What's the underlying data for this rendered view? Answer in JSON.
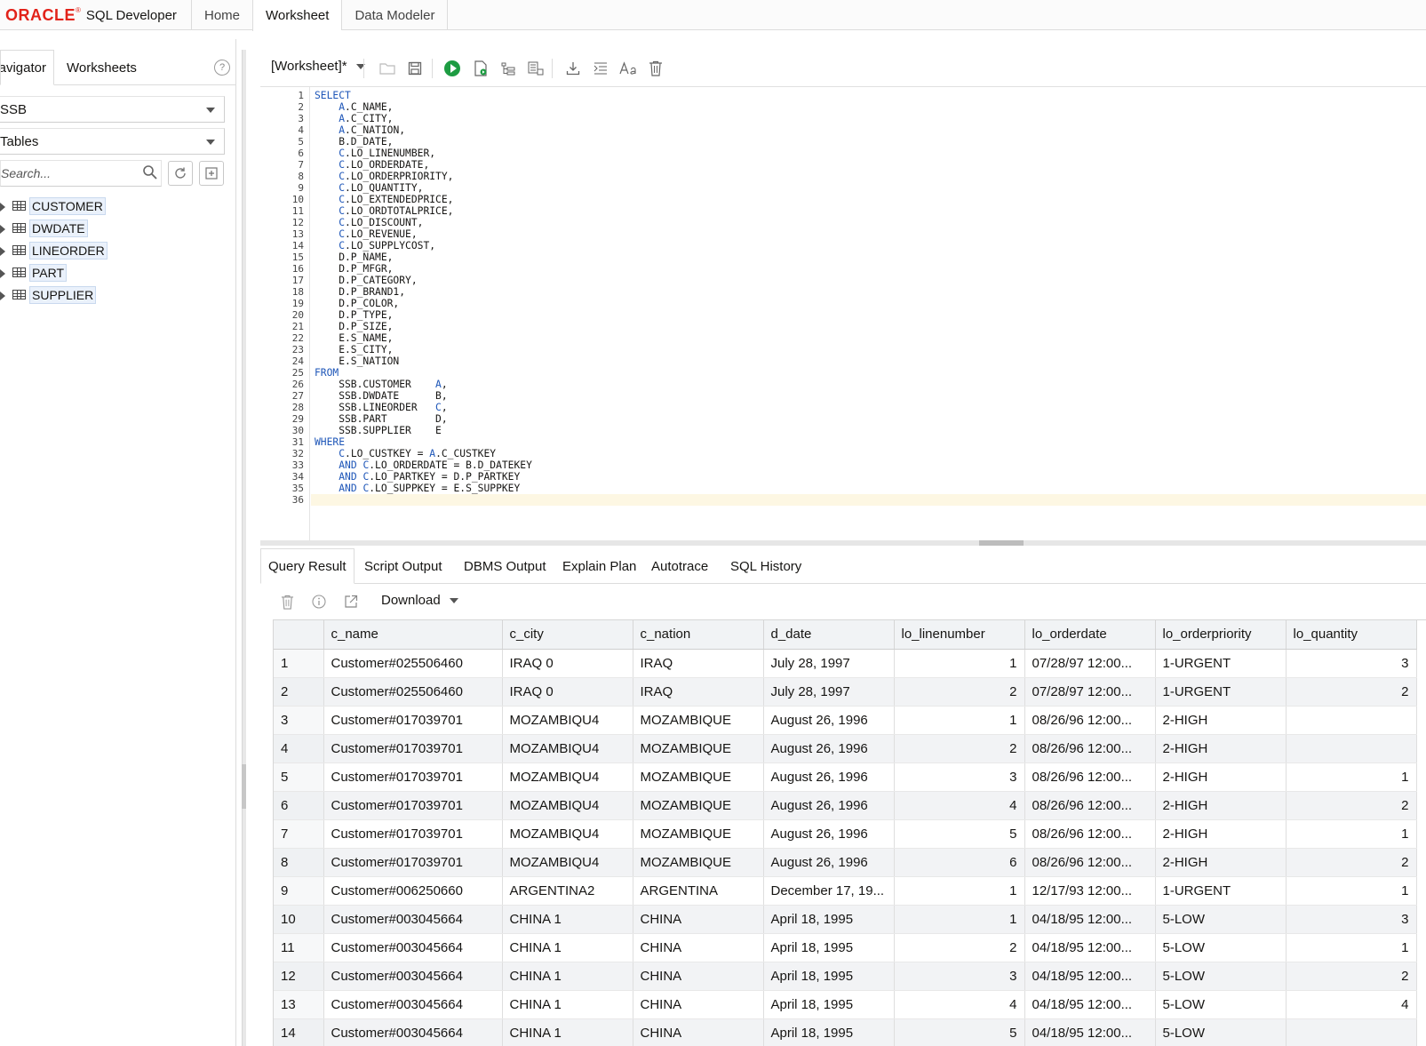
{
  "app": {
    "brand_oracle": "ORACLE",
    "brand_reg": "®",
    "brand_product": "SQL Developer",
    "tabs": [
      "Home",
      "Worksheet",
      "Data Modeler"
    ],
    "accent": "#e2231a"
  },
  "left": {
    "tab_navigator": "avigator",
    "tab_worksheets": "Worksheets",
    "help": "?",
    "schema": "SSB",
    "object_type": "Tables",
    "search_placeholder": "Search...",
    "tables": [
      "CUSTOMER",
      "DWDATE",
      "LINEORDER",
      "PART",
      "SUPPLIER"
    ]
  },
  "worksheet": {
    "title": "[Worksheet]*"
  },
  "editor": {
    "lines": [
      [
        [
          "kw",
          "SELECT"
        ]
      ],
      [
        [
          "",
          "    "
        ],
        [
          "kw",
          "A"
        ],
        [
          "",
          ".C_NAME,"
        ]
      ],
      [
        [
          "",
          "    "
        ],
        [
          "kw",
          "A"
        ],
        [
          "",
          ".C_CITY,"
        ]
      ],
      [
        [
          "",
          "    "
        ],
        [
          "kw",
          "A"
        ],
        [
          "",
          ".C_NATION,"
        ]
      ],
      [
        [
          "",
          "    B.D_DATE,"
        ]
      ],
      [
        [
          "",
          "    "
        ],
        [
          "kw",
          "C"
        ],
        [
          "",
          ".LO_LINENUMBER,"
        ]
      ],
      [
        [
          "",
          "    "
        ],
        [
          "kw",
          "C"
        ],
        [
          "",
          ".LO_ORDERDATE,"
        ]
      ],
      [
        [
          "",
          "    "
        ],
        [
          "kw",
          "C"
        ],
        [
          "",
          ".LO_ORDERPRIORITY,"
        ]
      ],
      [
        [
          "",
          "    "
        ],
        [
          "kw",
          "C"
        ],
        [
          "",
          ".LO_QUANTITY,"
        ]
      ],
      [
        [
          "",
          "    "
        ],
        [
          "kw",
          "C"
        ],
        [
          "",
          ".LO_EXTENDEDPRICE,"
        ]
      ],
      [
        [
          "",
          "    "
        ],
        [
          "kw",
          "C"
        ],
        [
          "",
          ".LO_ORDTOTALPRICE,"
        ]
      ],
      [
        [
          "",
          "    "
        ],
        [
          "kw",
          "C"
        ],
        [
          "",
          ".LO_DISCOUNT,"
        ]
      ],
      [
        [
          "",
          "    "
        ],
        [
          "kw",
          "C"
        ],
        [
          "",
          ".LO_REVENUE,"
        ]
      ],
      [
        [
          "",
          "    "
        ],
        [
          "kw",
          "C"
        ],
        [
          "",
          ".LO_SUPPLYCOST,"
        ]
      ],
      [
        [
          "",
          "    D.P_NAME,"
        ]
      ],
      [
        [
          "",
          "    D.P_MFGR,"
        ]
      ],
      [
        [
          "",
          "    D.P_CATEGORY,"
        ]
      ],
      [
        [
          "",
          "    D.P_BRAND1,"
        ]
      ],
      [
        [
          "",
          "    D.P_COLOR,"
        ]
      ],
      [
        [
          "",
          "    D.P_TYPE,"
        ]
      ],
      [
        [
          "",
          "    D.P_SIZE,"
        ]
      ],
      [
        [
          "",
          "    E.S_NAME,"
        ]
      ],
      [
        [
          "",
          "    E.S_CITY,"
        ]
      ],
      [
        [
          "",
          "    E.S_NATION"
        ]
      ],
      [
        [
          "kw",
          "FROM"
        ]
      ],
      [
        [
          "",
          "    SSB.CUSTOMER    "
        ],
        [
          "kw",
          "A"
        ],
        [
          "",
          ","
        ]
      ],
      [
        [
          "",
          "    SSB.DWDATE      B,"
        ]
      ],
      [
        [
          "",
          "    SSB.LINEORDER   "
        ],
        [
          "kw",
          "C"
        ],
        [
          "",
          ","
        ]
      ],
      [
        [
          "",
          "    SSB.PART        D,"
        ]
      ],
      [
        [
          "",
          "    SSB.SUPPLIER    E"
        ]
      ],
      [
        [
          "kw",
          "WHERE"
        ]
      ],
      [
        [
          "",
          "    "
        ],
        [
          "kw",
          "C"
        ],
        [
          "",
          ".LO_CUSTKEY = "
        ],
        [
          "kw",
          "A"
        ],
        [
          "",
          ".C_CUSTKEY"
        ]
      ],
      [
        [
          "",
          "    "
        ],
        [
          "kw",
          "AND"
        ],
        [
          "",
          " "
        ],
        [
          "kw",
          "C"
        ],
        [
          "",
          ".LO_ORDERDATE = B.D_DATEKEY"
        ]
      ],
      [
        [
          "",
          "    "
        ],
        [
          "kw",
          "AND"
        ],
        [
          "",
          " "
        ],
        [
          "kw",
          "C"
        ],
        [
          "",
          ".LO_PARTKEY = D.P_PARTKEY"
        ]
      ],
      [
        [
          "",
          "    "
        ],
        [
          "kw",
          "AND"
        ],
        [
          "",
          " "
        ],
        [
          "kw",
          "C"
        ],
        [
          "",
          ".LO_SUPPKEY = E.S_SUPPKEY"
        ]
      ],
      [
        [
          "",
          ""
        ]
      ]
    ]
  },
  "results": {
    "tabs": [
      "Query Result",
      "Script Output",
      "DBMS Output",
      "Explain Plan",
      "Autotrace",
      "SQL History"
    ],
    "download_label": "Download",
    "columns": [
      "c_name",
      "c_city",
      "c_nation",
      "d_date",
      "lo_linenumber",
      "lo_orderdate",
      "lo_orderpriority",
      "lo_quantity"
    ],
    "rows": [
      [
        "1",
        "Customer#025506460",
        "IRAQ 0",
        "IRAQ",
        "July 28, 1997",
        "1",
        "07/28/97 12:00...",
        "1-URGENT",
        "3"
      ],
      [
        "2",
        "Customer#025506460",
        "IRAQ 0",
        "IRAQ",
        "July 28, 1997",
        "2",
        "07/28/97 12:00...",
        "1-URGENT",
        "2"
      ],
      [
        "3",
        "Customer#017039701",
        "MOZAMBIQU4",
        "MOZAMBIQUE",
        "August 26, 1996",
        "1",
        "08/26/96 12:00...",
        "2-HIGH",
        ""
      ],
      [
        "4",
        "Customer#017039701",
        "MOZAMBIQU4",
        "MOZAMBIQUE",
        "August 26, 1996",
        "2",
        "08/26/96 12:00...",
        "2-HIGH",
        ""
      ],
      [
        "5",
        "Customer#017039701",
        "MOZAMBIQU4",
        "MOZAMBIQUE",
        "August 26, 1996",
        "3",
        "08/26/96 12:00...",
        "2-HIGH",
        "1"
      ],
      [
        "6",
        "Customer#017039701",
        "MOZAMBIQU4",
        "MOZAMBIQUE",
        "August 26, 1996",
        "4",
        "08/26/96 12:00...",
        "2-HIGH",
        "2"
      ],
      [
        "7",
        "Customer#017039701",
        "MOZAMBIQU4",
        "MOZAMBIQUE",
        "August 26, 1996",
        "5",
        "08/26/96 12:00...",
        "2-HIGH",
        "1"
      ],
      [
        "8",
        "Customer#017039701",
        "MOZAMBIQU4",
        "MOZAMBIQUE",
        "August 26, 1996",
        "6",
        "08/26/96 12:00...",
        "2-HIGH",
        "2"
      ],
      [
        "9",
        "Customer#006250660",
        "ARGENTINA2",
        "ARGENTINA",
        "December 17, 19...",
        "1",
        "12/17/93 12:00...",
        "1-URGENT",
        "1"
      ],
      [
        "10",
        "Customer#003045664",
        "CHINA 1",
        "CHINA",
        "April 18, 1995",
        "1",
        "04/18/95 12:00...",
        "5-LOW",
        "3"
      ],
      [
        "11",
        "Customer#003045664",
        "CHINA 1",
        "CHINA",
        "April 18, 1995",
        "2",
        "04/18/95 12:00...",
        "5-LOW",
        "1"
      ],
      [
        "12",
        "Customer#003045664",
        "CHINA 1",
        "CHINA",
        "April 18, 1995",
        "3",
        "04/18/95 12:00...",
        "5-LOW",
        "2"
      ],
      [
        "13",
        "Customer#003045664",
        "CHINA 1",
        "CHINA",
        "April 18, 1995",
        "4",
        "04/18/95 12:00...",
        "5-LOW",
        "4"
      ],
      [
        "14",
        "Customer#003045664",
        "CHINA 1",
        "CHINA",
        "April 18, 1995",
        "5",
        "04/18/95 12:00...",
        "5-LOW",
        ""
      ]
    ]
  }
}
